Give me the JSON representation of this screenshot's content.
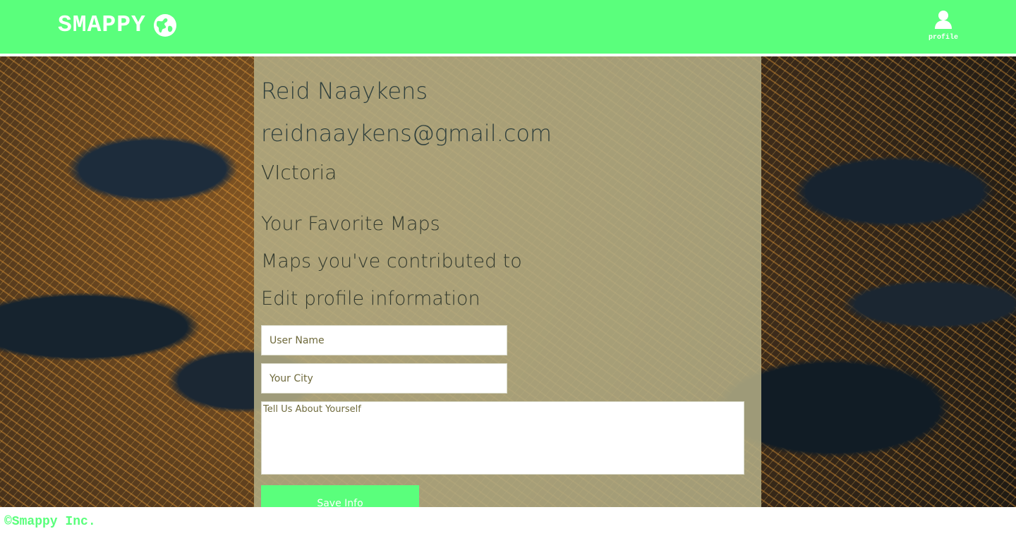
{
  "header": {
    "brand": "SMAPPY",
    "brand_icon": "globe-icon",
    "profile_label": "profile",
    "profile_icon": "user-icon",
    "color": "#5aff7c"
  },
  "profile": {
    "name": "Reid Naaykens",
    "email": "reidnaaykens@gmail.com",
    "city": "VIctoria"
  },
  "links": {
    "favorites": "Your Favorite Maps",
    "contributed": "Maps you've contributed to",
    "edit": "Edit profile information"
  },
  "form": {
    "username_placeholder": "User Name",
    "city_placeholder": "Your City",
    "about_placeholder": "Tell Us About Yourself",
    "save_label": "Save Info"
  },
  "footer": {
    "copyright": "©Smappy Inc."
  }
}
